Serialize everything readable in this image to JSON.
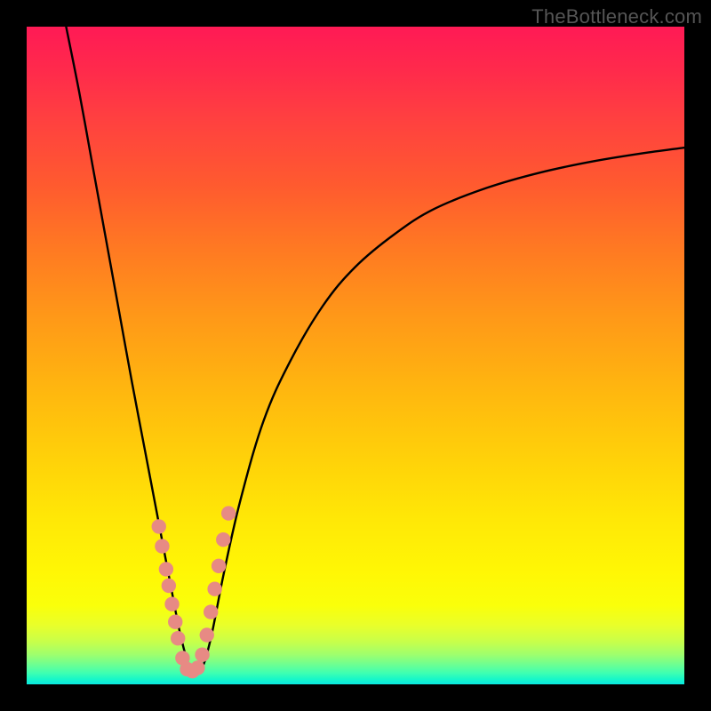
{
  "attribution": "TheBottleneck.com",
  "colors": {
    "frame": "#000000",
    "curve": "#000000",
    "marker_fill": "#e78a84",
    "marker_stroke": "#e78a84"
  },
  "chart_data": {
    "type": "line",
    "title": "",
    "xlabel": "",
    "ylabel": "",
    "xlim": [
      0,
      100
    ],
    "ylim": [
      0,
      100
    ],
    "grid": false,
    "legend": false,
    "note": "Axis values are pixel-proportional estimates; no numeric labels are rendered in the image.",
    "series": [
      {
        "name": "bottleneck-curve",
        "x": [
          6,
          8,
          10,
          12,
          14,
          16,
          18,
          20,
          22,
          23.5,
          25,
          26.5,
          28,
          30,
          32.5,
          36,
          40,
          45,
          50,
          56,
          62,
          70,
          78,
          86,
          94,
          100
        ],
        "y": [
          100,
          90,
          79,
          68,
          57,
          46,
          35.5,
          25,
          14.5,
          7,
          2.2,
          2.2,
          7,
          17,
          28,
          40,
          49,
          57.5,
          63.5,
          68.5,
          72.3,
          75.5,
          77.8,
          79.5,
          80.8,
          81.6
        ]
      },
      {
        "name": "marker-dots",
        "x": [
          20.1,
          20.6,
          21.2,
          21.6,
          22.1,
          22.6,
          23.0,
          23.7,
          24.4,
          25.2,
          26.0,
          26.7,
          27.4,
          28.0,
          28.6,
          29.2,
          29.9,
          30.7
        ],
        "y": [
          24.0,
          21.0,
          17.5,
          15.0,
          12.2,
          9.5,
          7.0,
          4.0,
          2.3,
          2.0,
          2.5,
          4.5,
          7.5,
          11.0,
          14.5,
          18.0,
          22.0,
          26.0
        ]
      }
    ]
  }
}
